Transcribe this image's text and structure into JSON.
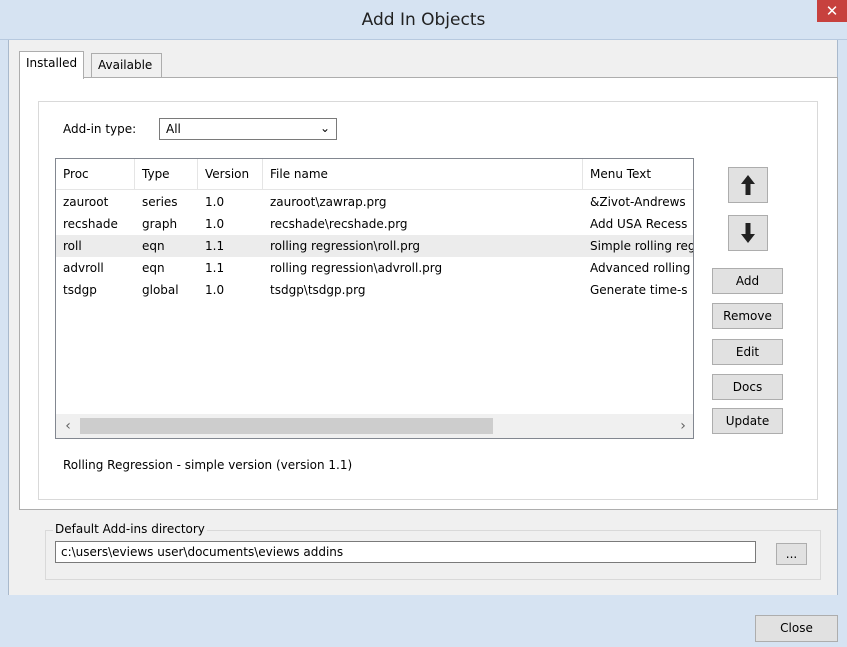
{
  "window": {
    "title": "Add In Objects",
    "close_glyph": "✕"
  },
  "tabs": [
    {
      "label": "Installed",
      "active": true
    },
    {
      "label": "Available",
      "active": false
    }
  ],
  "addin_type": {
    "label": "Add-in type:",
    "selected": "All"
  },
  "table": {
    "columns": [
      "Proc",
      "Type",
      "Version",
      "File name",
      "Menu Text"
    ],
    "rows": [
      [
        "zauroot",
        "series",
        "1.0",
        "zauroot\\zawrap.prg",
        "&Zivot-Andrews"
      ],
      [
        "recshade",
        "graph",
        "1.0",
        "recshade\\recshade.prg",
        "Add USA Recess"
      ],
      [
        "roll",
        "eqn",
        "1.1",
        "rolling regression\\roll.prg",
        "Simple rolling reg"
      ],
      [
        "advroll",
        "eqn",
        "1.1",
        "rolling regression\\advroll.prg",
        "Advanced rolling"
      ],
      [
        "tsdgp",
        "global",
        "1.0",
        "tsdgp\\tsdgp.prg",
        "Generate time-s"
      ]
    ],
    "selected_row": 2
  },
  "side_buttons": {
    "up_icon": "arrow-up-icon",
    "down_icon": "arrow-down-icon",
    "add": "Add",
    "remove": "Remove",
    "edit": "Edit",
    "docs": "Docs",
    "update": "Update"
  },
  "status_text": "Rolling Regression - simple version (version 1.1)",
  "directory": {
    "label": "Default Add-ins directory",
    "value": "c:\\users\\eviews user\\documents\\eviews addins",
    "browse": "..."
  },
  "footer": {
    "close": "Close"
  },
  "colors": {
    "titlebar": "#d6e3f2",
    "close_button": "#c7413e",
    "selection": "#ececec"
  }
}
